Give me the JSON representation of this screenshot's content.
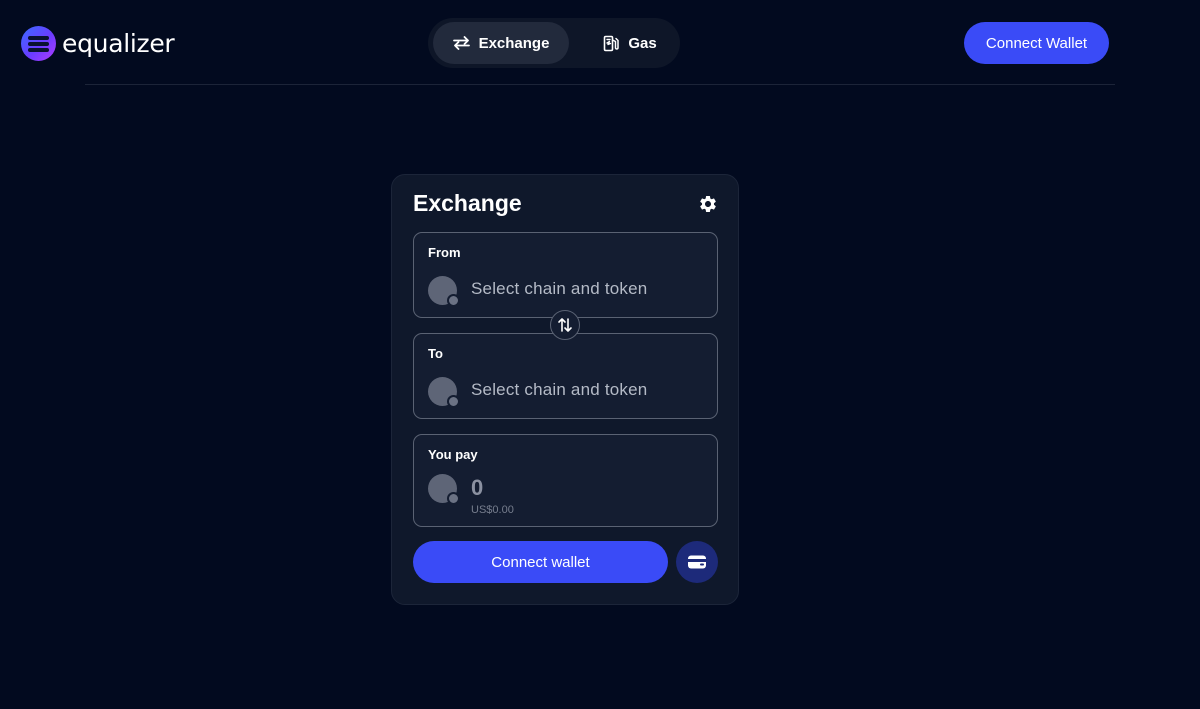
{
  "app": {
    "logo_text": "equalizer"
  },
  "nav": {
    "tabs": [
      {
        "label": "Exchange",
        "icon": "swap-arrows-icon",
        "active": true
      },
      {
        "label": "Gas",
        "icon": "gas-pump-icon",
        "active": false
      }
    ]
  },
  "header": {
    "connect_label": "Connect Wallet"
  },
  "card": {
    "title": "Exchange",
    "from": {
      "label": "From",
      "placeholder": "Select chain and token"
    },
    "to": {
      "label": "To",
      "placeholder": "Select chain and token"
    },
    "pay": {
      "label": "You pay",
      "amount": "0",
      "usd": "US$0.00"
    },
    "connect_label": "Connect wallet"
  },
  "colors": {
    "background": "#020a1f",
    "card": "#0f182b",
    "accent": "#3a4bf7",
    "wallet_button": "#1d2a7a"
  }
}
